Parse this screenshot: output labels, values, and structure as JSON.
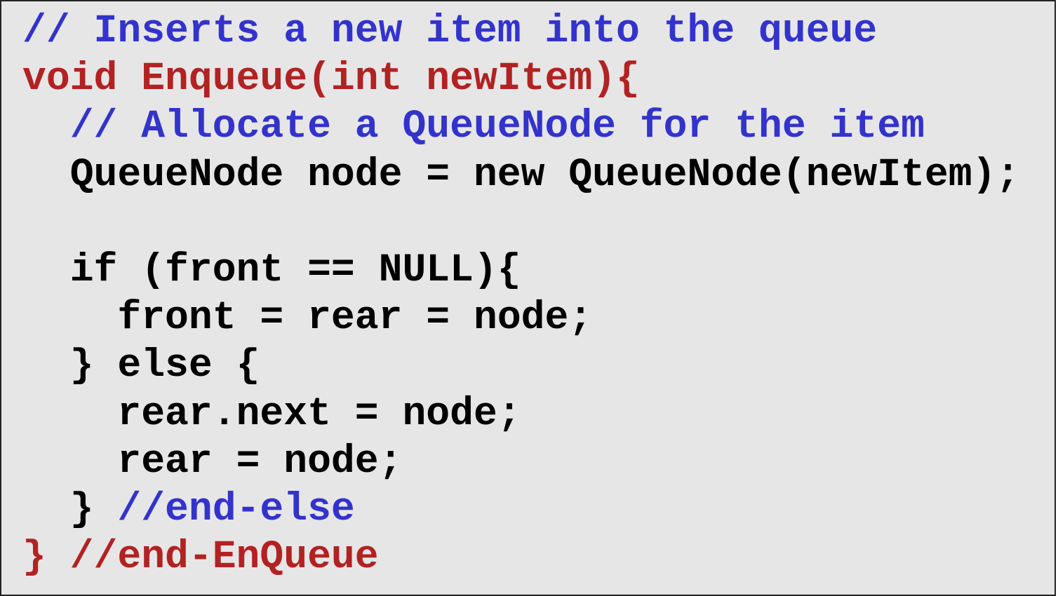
{
  "colors": {
    "background": "#e6e6e6",
    "border": "#222222",
    "comment_blue": "#3333cc",
    "keyword_red": "#b22222",
    "code_black": "#000000"
  },
  "code": {
    "lines": [
      {
        "indent": "",
        "segments": [
          {
            "text": "// Inserts a new item into the queue",
            "color": "blue"
          }
        ]
      },
      {
        "indent": "",
        "segments": [
          {
            "text": "void Enqueue(int newItem){",
            "color": "red"
          }
        ]
      },
      {
        "indent": "  ",
        "segments": [
          {
            "text": "// Allocate a QueueNode for the item",
            "color": "blue"
          }
        ]
      },
      {
        "indent": "  ",
        "segments": [
          {
            "text": "QueueNode node = new QueueNode(newItem);",
            "color": "black"
          }
        ]
      },
      {
        "indent": "",
        "segments": []
      },
      {
        "indent": "  ",
        "segments": [
          {
            "text": "if (front == NULL){",
            "color": "black"
          }
        ]
      },
      {
        "indent": "    ",
        "segments": [
          {
            "text": "front = rear = node;",
            "color": "black"
          }
        ]
      },
      {
        "indent": "  ",
        "segments": [
          {
            "text": "} else {",
            "color": "black"
          }
        ]
      },
      {
        "indent": "    ",
        "segments": [
          {
            "text": "rear.next = node;",
            "color": "black"
          }
        ]
      },
      {
        "indent": "    ",
        "segments": [
          {
            "text": "rear = node;",
            "color": "black"
          }
        ]
      },
      {
        "indent": "  ",
        "segments": [
          {
            "text": "} ",
            "color": "black"
          },
          {
            "text": "//end-else",
            "color": "blue"
          }
        ]
      },
      {
        "indent": "",
        "segments": [
          {
            "text": "} //end-EnQueue",
            "color": "red"
          }
        ]
      }
    ]
  }
}
